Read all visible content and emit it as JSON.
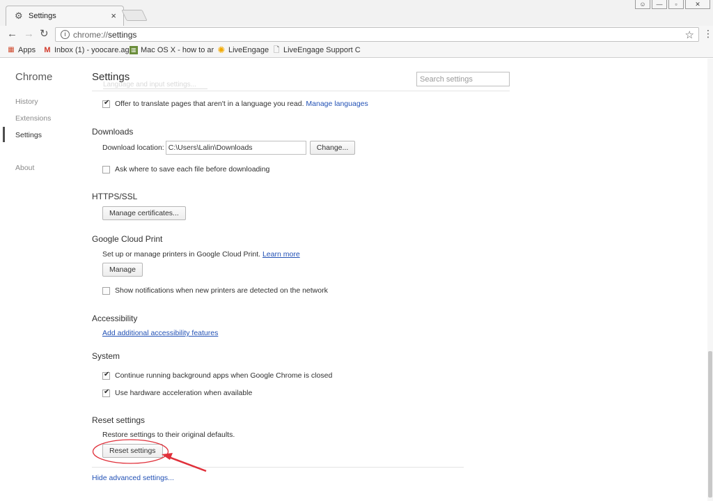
{
  "browser": {
    "tab_title": "Settings",
    "tab_icon": "gear-icon",
    "tab_close": "×",
    "url_scheme": "chrome://",
    "url_path": "settings",
    "bookmarks": [
      {
        "label": "Apps",
        "icon": "apps-grid-icon"
      },
      {
        "label": "Inbox (1) - yoocare.ag",
        "icon": "gmail-icon"
      },
      {
        "label": "Mac OS X - how to ar",
        "icon": "bookmark-page-icon"
      },
      {
        "label": "LiveEngage",
        "icon": "liveengage-icon"
      },
      {
        "label": "LiveEngage Support C",
        "icon": "page-icon"
      }
    ]
  },
  "sidebar": {
    "brand": "Chrome",
    "items": [
      "History",
      "Extensions",
      "Settings",
      "About"
    ],
    "active": "Settings"
  },
  "main": {
    "title": "Settings",
    "search_placeholder": "Search settings",
    "ghost_row": "Language and input settings...",
    "translate": {
      "label": "Offer to translate pages that aren't in a language you read.",
      "link": "Manage languages",
      "checked": true
    },
    "downloads": {
      "title": "Downloads",
      "location_label": "Download location:",
      "location_value": "C:\\Users\\Lalin\\Downloads",
      "change_button": "Change...",
      "ask_label": "Ask where to save each file before downloading",
      "ask_checked": false
    },
    "https": {
      "title": "HTTPS/SSL",
      "manage_button": "Manage certificates..."
    },
    "cloud_print": {
      "title": "Google Cloud Print",
      "description": "Set up or manage printers in Google Cloud Print.",
      "learn_more": "Learn more",
      "manage_button": "Manage",
      "notify_label": "Show notifications when new printers are detected on the network",
      "notify_checked": false
    },
    "accessibility": {
      "title": "Accessibility",
      "link": "Add additional accessibility features"
    },
    "system": {
      "title": "System",
      "background_label": "Continue running background apps when Google Chrome is closed",
      "background_checked": true,
      "hw_label": "Use hardware acceleration when available",
      "hw_checked": true
    },
    "reset": {
      "title": "Reset settings",
      "description": "Restore settings to their original defaults.",
      "button": "Reset settings"
    },
    "hide_advanced": "Hide advanced settings..."
  },
  "colors": {
    "link": "#2251b5",
    "annotation": "#e0303a"
  }
}
